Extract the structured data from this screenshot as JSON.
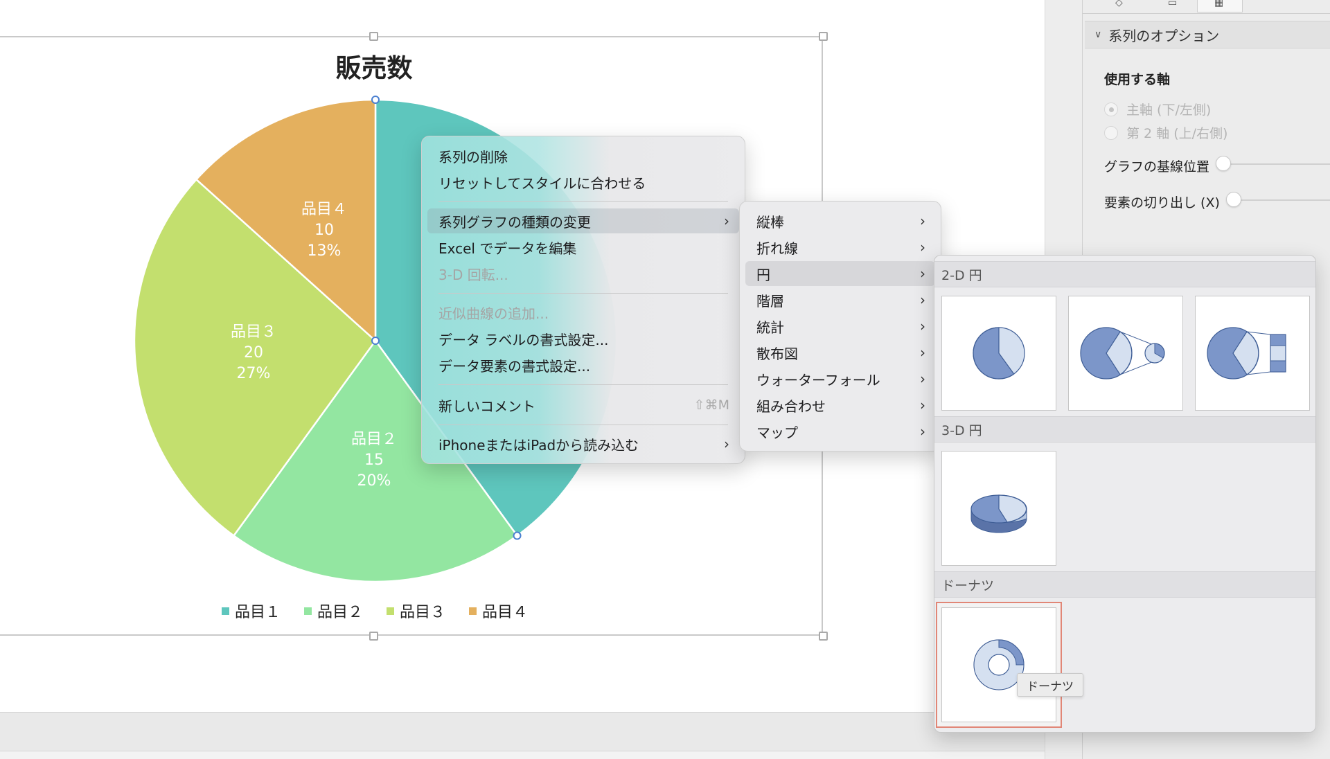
{
  "chart": {
    "title": "販売数",
    "slice_labels": [
      {
        "name": "品目１",
        "value": "",
        "percent": ""
      },
      {
        "name": "品目２",
        "value": "15",
        "percent": "20%"
      },
      {
        "name": "品目３",
        "value": "20",
        "percent": "27%"
      },
      {
        "name": "品目４",
        "value": "10",
        "percent": "13%"
      }
    ],
    "legend": [
      "品目１",
      "品目２",
      "品目３",
      "品目４"
    ]
  },
  "chart_data": {
    "type": "pie",
    "title": "販売数",
    "categories": [
      "品目１",
      "品目２",
      "品目３",
      "品目４"
    ],
    "values": [
      30,
      15,
      20,
      10
    ],
    "percents": [
      40,
      20,
      27,
      13
    ],
    "colors": [
      "#5ec6bd",
      "#93e6a1",
      "#c3df6e",
      "#e4b05e"
    ],
    "legend_position": "bottom"
  },
  "context_menu": {
    "items": [
      {
        "label": "系列の削除",
        "disabled": false
      },
      {
        "label": "リセットしてスタイルに合わせる",
        "disabled": false
      },
      {
        "label": "系列グラフの種類の変更",
        "disabled": false,
        "has_submenu": true,
        "highlighted": true
      },
      {
        "label": "Excel でデータを編集",
        "disabled": false
      },
      {
        "label": "3-D 回転...",
        "disabled": true
      },
      {
        "label": "近似曲線の追加...",
        "disabled": true
      },
      {
        "label": "データ ラベルの書式設定...",
        "disabled": false
      },
      {
        "label": "データ要素の書式設定...",
        "disabled": false
      },
      {
        "label": "新しいコメント",
        "disabled": false,
        "shortcut": "⇧⌘M"
      },
      {
        "label": "iPhoneまたはiPadから読み込む",
        "disabled": false,
        "has_submenu": true
      }
    ]
  },
  "chart_type_menu": {
    "items": [
      {
        "label": "縦棒"
      },
      {
        "label": "折れ線"
      },
      {
        "label": "円",
        "highlighted": true
      },
      {
        "label": "階層"
      },
      {
        "label": "統計"
      },
      {
        "label": "散布図"
      },
      {
        "label": "ウォーターフォール"
      },
      {
        "label": "組み合わせ"
      },
      {
        "label": "マップ"
      }
    ]
  },
  "gallery": {
    "sections": [
      {
        "title": "2-D 円"
      },
      {
        "title": "3-D 円"
      },
      {
        "title": "ドーナツ"
      }
    ],
    "tooltip": "ドーナツ",
    "colors": {
      "dark": "#7c96c9",
      "light": "#d5e0f0",
      "stroke": "#3f5e96",
      "selection": "#e18676"
    }
  },
  "format_panel": {
    "section_title": "系列のオプション",
    "axis_heading": "使用する軸",
    "radio_primary": "主軸 (下/左側)",
    "radio_secondary": "第 2 軸 (上/右側)",
    "baseline_label": "グラフの基線位置",
    "explosion_label": "要素の切り出し (X)"
  }
}
